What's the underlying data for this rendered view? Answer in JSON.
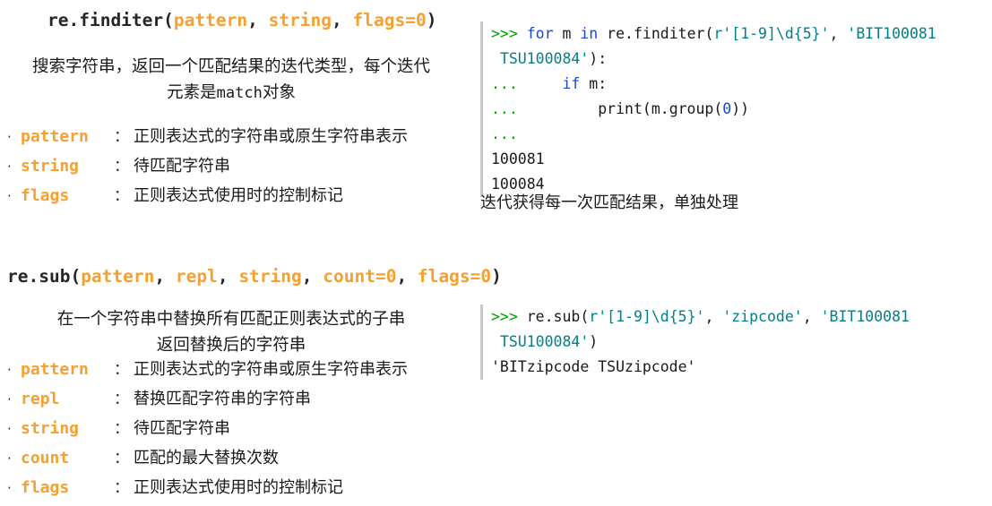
{
  "sections": [
    {
      "id": "finditer",
      "signature": {
        "prefix": "re.finditer(",
        "params": [
          "pattern",
          "string",
          "flags=0"
        ],
        "suffix": ")",
        "full": "re.finditer(pattern, string, flags=0)"
      },
      "description_lines": [
        "搜索字符串，返回一个匹配结果的迭代类型，每个迭代",
        "元素是match对象"
      ],
      "params": [
        {
          "bullet": "·",
          "name": "pattern",
          "colon": "：",
          "desc": "正则表达式的字符串或原生字符串表示"
        },
        {
          "bullet": "·",
          "name": "string",
          "colon": "：",
          "desc": "待匹配字符串"
        },
        {
          "bullet": "·",
          "name": "flags",
          "colon": "：",
          "desc": "正则表达式使用时的控制标记"
        }
      ],
      "code_lines": [
        [
          {
            "t": ">>> ",
            "c": "prompt"
          },
          {
            "t": "for",
            "c": "kw"
          },
          {
            "t": " m ",
            "c": "plain"
          },
          {
            "t": "in",
            "c": "kw"
          },
          {
            "t": " re.finditer(",
            "c": "plain"
          },
          {
            "t": "r'[1-9]\\d{5}'",
            "c": "str"
          },
          {
            "t": ", ",
            "c": "plain"
          },
          {
            "t": "'BIT100081",
            "c": "str"
          }
        ],
        [
          {
            "t": " ",
            "c": "plain"
          },
          {
            "t": "TSU100084'",
            "c": "str"
          },
          {
            "t": "):",
            "c": "plain"
          }
        ],
        [
          {
            "t": "...",
            "c": "prompt"
          },
          {
            "t": "     ",
            "c": "plain"
          },
          {
            "t": "if",
            "c": "kw"
          },
          {
            "t": " m:",
            "c": "plain"
          }
        ],
        [
          {
            "t": "...",
            "c": "prompt"
          },
          {
            "t": "         print(m.group(",
            "c": "plain"
          },
          {
            "t": "0",
            "c": "num"
          },
          {
            "t": "))",
            "c": "plain"
          }
        ],
        [
          {
            "t": "...",
            "c": "prompt"
          }
        ],
        [
          {
            "t": "100081",
            "c": "plain"
          }
        ],
        [
          {
            "t": "100084",
            "c": "plain"
          }
        ]
      ],
      "caption": "迭代获得每一次匹配结果，单独处理"
    },
    {
      "id": "sub",
      "signature": {
        "prefix": "re.sub(",
        "params": [
          "pattern",
          "repl",
          "string",
          "count=0",
          "flags=0"
        ],
        "suffix": ")",
        "full": "re.sub(pattern, repl, string, count=0, flags=0)"
      },
      "description_lines": [
        "在一个字符串中替换所有匹配正则表达式的子串",
        "返回替换后的字符串"
      ],
      "params": [
        {
          "bullet": "·",
          "name": "pattern",
          "colon": "：",
          "desc": "正则表达式的字符串或原生字符串表示"
        },
        {
          "bullet": "·",
          "name": "repl",
          "colon": "：",
          "desc": "替换匹配字符串的字符串"
        },
        {
          "bullet": "·",
          "name": "string",
          "colon": "：",
          "desc": "待匹配字符串"
        },
        {
          "bullet": "·",
          "name": "count",
          "colon": "：",
          "desc": "匹配的最大替换次数"
        },
        {
          "bullet": "·",
          "name": "flags",
          "colon": "：",
          "desc": "正则表达式使用时的控制标记"
        }
      ],
      "code_lines": [
        [
          {
            "t": ">>> ",
            "c": "prompt"
          },
          {
            "t": "re.sub(",
            "c": "plain"
          },
          {
            "t": "r'[1-9]\\d{5}'",
            "c": "str"
          },
          {
            "t": ", ",
            "c": "plain"
          },
          {
            "t": "'zipcode'",
            "c": "str"
          },
          {
            "t": ", ",
            "c": "plain"
          },
          {
            "t": "'BIT100081",
            "c": "str"
          }
        ],
        [
          {
            "t": " ",
            "c": "plain"
          },
          {
            "t": "TSU100084'",
            "c": "str"
          },
          {
            "t": ")",
            "c": "plain"
          }
        ],
        [
          {
            "t": "'BITzipcode TSUzipcode'",
            "c": "plain"
          }
        ]
      ],
      "caption": ""
    }
  ],
  "colors": {
    "param_orange": "#f5a030",
    "prompt_green": "#00a000",
    "keyword_blue": "#1947d1",
    "string_teal": "#00808a",
    "text_dark": "#1a1a1a",
    "code_border_gray": "#c8c8c8",
    "background": "#ffffff"
  }
}
